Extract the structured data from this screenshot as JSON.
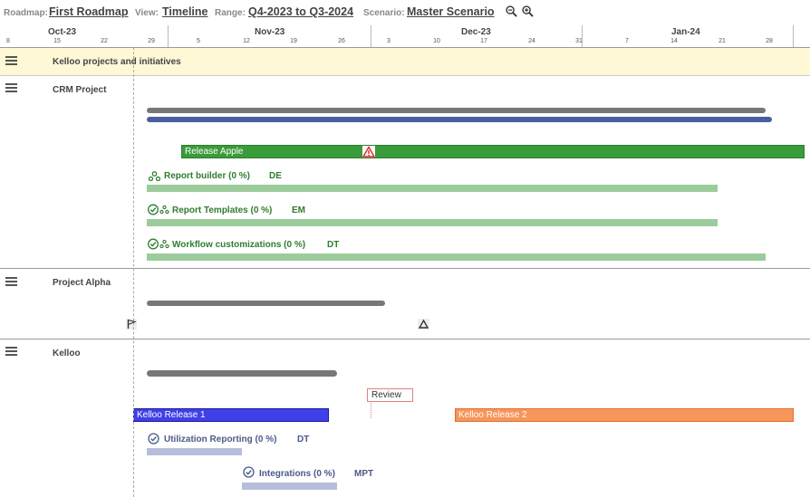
{
  "toolbar": {
    "roadmap_label": "Roadmap:",
    "roadmap_value": "First Roadmap",
    "view_label": "View:",
    "view_value": "Timeline",
    "range_label": "Range:",
    "range_value": "Q4-2023 to Q3-2024",
    "scenario_label": "Scenario:",
    "scenario_value": "Master Scenario",
    "zoom_out_icon": "zoom-out-icon",
    "zoom_in_icon": "zoom-in-icon"
  },
  "timescale": {
    "months": [
      "Oct-23",
      "Nov-23",
      "Dec-23",
      "Jan-24"
    ],
    "days": [
      "8",
      "15",
      "22",
      "29",
      "5",
      "12",
      "19",
      "26",
      "3",
      "10",
      "17",
      "24",
      "31",
      "7",
      "14",
      "21",
      "28"
    ]
  },
  "groups": {
    "top_banner": "Kelloo projects and initiatives",
    "crm": {
      "title": "CRM Project",
      "release": "Release Apple",
      "features": [
        {
          "name": "Report builder (0 %)",
          "owner": "DE"
        },
        {
          "name": "Report Templates (0 %)",
          "owner": "EM"
        },
        {
          "name": "Workflow customizations (0 %)",
          "owner": "DT"
        }
      ]
    },
    "alpha": {
      "title": "Project Alpha"
    },
    "kelloo": {
      "title": "Kelloo",
      "review": "Review",
      "release1": "Kelloo Release 1",
      "release2": "Kelloo Release 2",
      "features": [
        {
          "name": "Utilization Reporting (0 %)",
          "owner": "DT"
        },
        {
          "name": "Integrations (0 %)",
          "owner": "MPT"
        }
      ]
    }
  },
  "colors": {
    "green_release": "#3a9b3a",
    "feature_green": "#9ccc9c",
    "blue_release": "#4040e8",
    "orange_release": "#f7955a",
    "feature_blue": "#b7bedb",
    "banner_bg": "#fff8d6"
  }
}
